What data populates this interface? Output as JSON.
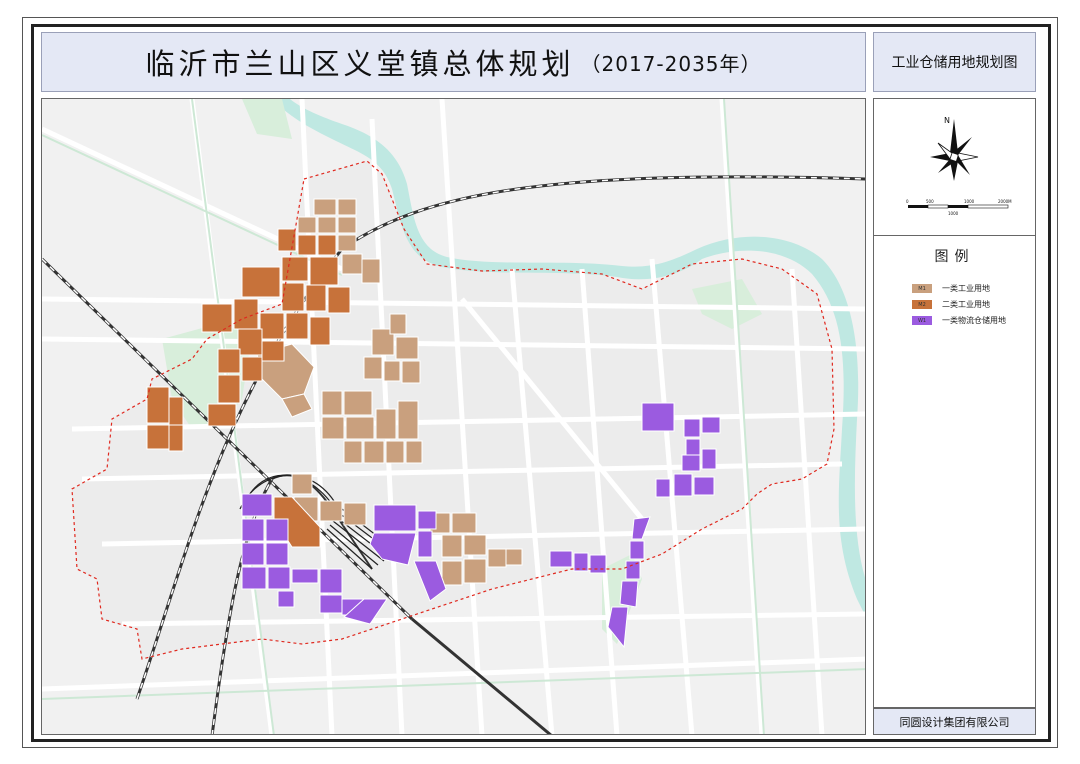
{
  "title": {
    "main": "临沂市兰山区义堂镇总体规划",
    "years": "（2017-2035年）"
  },
  "map_type": "工业仓储用地规划图",
  "compass": {
    "north_label": "N",
    "icon": "north-arrow-compass-icon",
    "scale_labels": [
      "0",
      "500",
      "1000",
      "2000M"
    ],
    "scale_mid_label": "1000"
  },
  "legend": {
    "title": "图例",
    "items": [
      {
        "code": "M1",
        "label": "一类工业用地",
        "color": "#c9a07e"
      },
      {
        "code": "M2",
        "label": "二类工业用地",
        "color": "#c7723a"
      },
      {
        "code": "W1",
        "label": "一类物流仓储用地",
        "color": "#9b5be0"
      }
    ]
  },
  "company": "同圆设计集团有限公司",
  "colors": {
    "m1": "#c9a07e",
    "m2": "#c7723a",
    "w1": "#9b5be0",
    "river": "#bfe8e2",
    "green": "#d8eedb",
    "boundary": "#e0281e",
    "road": "#ffffff",
    "land": "#ececec"
  }
}
